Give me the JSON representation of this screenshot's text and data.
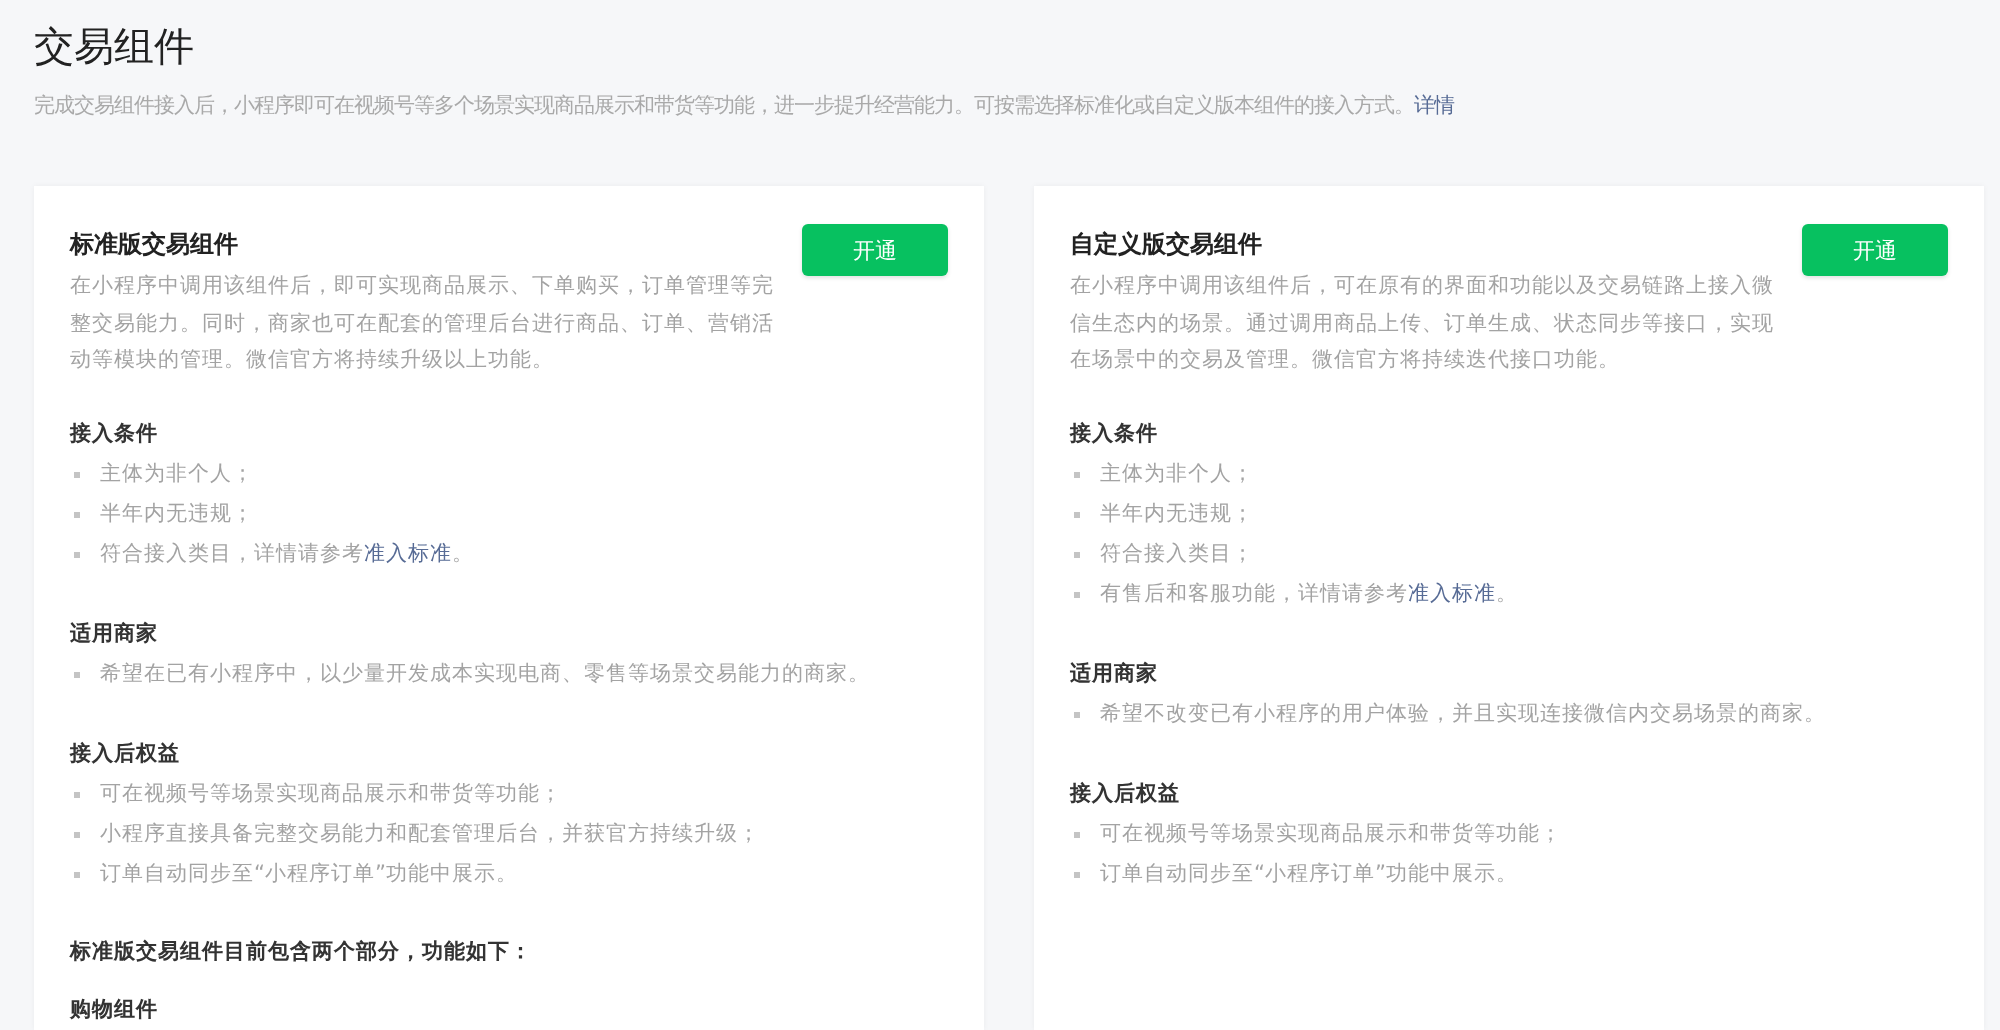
{
  "page": {
    "title": "交易组件",
    "description": "完成交易组件接入后，小程序即可在视频号等多个场景实现商品展示和带货等功能，进一步提升经营能力。可按需选择标准化或自定义版本组件的接入方式。",
    "link": "详情"
  },
  "cards": [
    {
      "title": "标准版交易组件",
      "button": "开通",
      "description": "在小程序中调用该组件后，即可实现商品展示、下单购买，订单管理等完整交易能力。同时，商家也可在配套的管理后台进行商品、订单、营销活动等模块的管理。微信官方将持续升级以上功能。",
      "sections": [
        {
          "heading": "接入条件",
          "items": [
            {
              "text": "主体为非个人；"
            },
            {
              "text": "半年内无违规；"
            },
            {
              "text": "符合接入类目，详情请参考",
              "link": "准入标准",
              "tail": "。"
            }
          ]
        },
        {
          "heading": "适用商家",
          "items": [
            {
              "text": "希望在已有小程序中，以少量开发成本实现电商、零售等场景交易能力的商家。"
            }
          ]
        },
        {
          "heading": "接入后权益",
          "items": [
            {
              "text": "可在视频号等场景实现商品展示和带货等功能；"
            },
            {
              "text": "小程序直接具备完整交易能力和配套管理后台，并获官方持续升级；"
            },
            {
              "text": "订单自动同步至“小程序订单”功能中展示。"
            }
          ]
        }
      ],
      "note": "标准版交易组件目前包含两个部分，功能如下：",
      "subheading": "购物组件"
    },
    {
      "title": "自定义版交易组件",
      "button": "开通",
      "description": "在小程序中调用该组件后，可在原有的界面和功能以及交易链路上接入微信生态内的场景。通过调用商品上传、订单生成、状态同步等接口，实现在场景中的交易及管理。微信官方将持续迭代接口功能。",
      "sections": [
        {
          "heading": "接入条件",
          "items": [
            {
              "text": "主体为非个人；"
            },
            {
              "text": "半年内无违规；"
            },
            {
              "text": "符合接入类目；"
            },
            {
              "text": "有售后和客服功能，详情请参考",
              "link": "准入标准",
              "tail": "。"
            }
          ]
        },
        {
          "heading": "适用商家",
          "items": [
            {
              "text": "希望不改变已有小程序的用户体验，并且实现连接微信内交易场景的商家。"
            }
          ]
        },
        {
          "heading": "接入后权益",
          "items": [
            {
              "text": "可在视频号等场景实现商品展示和带货等功能；"
            },
            {
              "text": "订单自动同步至“小程序订单”功能中展示。"
            }
          ]
        }
      ]
    }
  ]
}
